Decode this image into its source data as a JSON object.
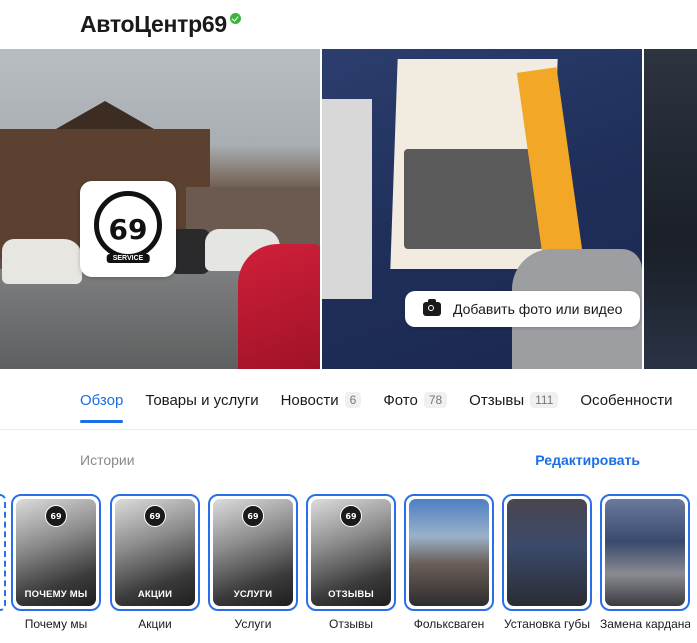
{
  "business": {
    "name": "АвтоЦентр69",
    "verified": true
  },
  "gallery": {
    "logo_text": "69",
    "logo_subtext": "SERVICE",
    "add_media_label": "Добавить фото или видео"
  },
  "tabs": [
    {
      "label": "Обзор",
      "count": null,
      "active": true
    },
    {
      "label": "Товары и услуги",
      "count": null,
      "active": false
    },
    {
      "label": "Новости",
      "count": "6",
      "active": false
    },
    {
      "label": "Фото",
      "count": "78",
      "active": false
    },
    {
      "label": "Отзывы",
      "count": "111",
      "active": false
    },
    {
      "label": "Особенности",
      "count": null,
      "active": false
    }
  ],
  "stories": {
    "title": "Истории",
    "edit_label": "Редактировать",
    "badge": "69",
    "items": [
      {
        "overlay": "ПОЧЕМУ МЫ",
        "label": "Почему мы"
      },
      {
        "overlay": "АКЦИИ",
        "label": "Акции"
      },
      {
        "overlay": "УСЛУГИ",
        "label": "Услуги"
      },
      {
        "overlay": "ОТЗЫВЫ",
        "label": "Отзывы"
      },
      {
        "overlay": "",
        "label": "Фольксваген"
      },
      {
        "overlay": "",
        "label": "Установка губы"
      },
      {
        "overlay": "",
        "label": "Замена кардана"
      }
    ]
  },
  "colors": {
    "accent": "#1a6ee6",
    "story_ring": "#2b6fe8",
    "verified": "#3cb43c"
  }
}
